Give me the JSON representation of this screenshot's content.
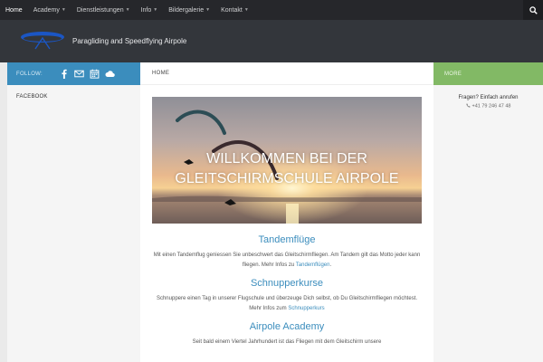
{
  "nav": {
    "items": [
      {
        "label": "Home",
        "dropdown": false
      },
      {
        "label": "Academy",
        "dropdown": true
      },
      {
        "label": "Dienstleistungen",
        "dropdown": true
      },
      {
        "label": "Info",
        "dropdown": true
      },
      {
        "label": "Bildergalerie",
        "dropdown": true
      },
      {
        "label": "Kontakt",
        "dropdown": true
      }
    ],
    "search_icon": "search-icon"
  },
  "header": {
    "site_title": "Paragliding and Speedflying Airpole"
  },
  "left": {
    "follow_label": "FOLLOW:",
    "social_icons": [
      "facebook-icon",
      "mail-icon",
      "calendar-icon",
      "cloud-icon"
    ],
    "widget_title": "FACEBOOK"
  },
  "main": {
    "breadcrumb": "HOME",
    "hero_title_line1": "WILLKOMMEN BEI DER",
    "hero_title_line2": "GLEITSCHIRMSCHULE AIRPOLE",
    "sections": [
      {
        "title": "Tandemflüge",
        "text": "Mit einen Tandemflug geniessen Sie unbeschwert das Gleitschirmfliegen. Am Tandem gilt das Motto jeder kann fliegen. Mehr Infos zu",
        "link": "Tandemflügen",
        "after": "."
      },
      {
        "title": "Schnupperkurse",
        "text": "Schnuppere einen Tag in unserer Flugschule und überzeuge Dich selbst, ob Du Gleitschirmfliegen möchtest. Mehr Infos zum",
        "link": "Schnupperkurs",
        "after": ""
      },
      {
        "title": "Airpole Academy",
        "text": "Seit bald einem Viertel Jahrhundert ist das Fliegen mit dem Gleitschirm unsere",
        "link": "",
        "after": ""
      }
    ]
  },
  "right": {
    "more_label": "MORE",
    "contact_question": "Fragen? Einfach anrufen",
    "phone": "+41 79 246 47 48"
  },
  "colors": {
    "nav_bg": "#26272b",
    "header_bg": "#33363b",
    "follow_blue": "#3b8dbd",
    "more_green": "#82b965",
    "accent_blue": "#3b8dbd"
  }
}
